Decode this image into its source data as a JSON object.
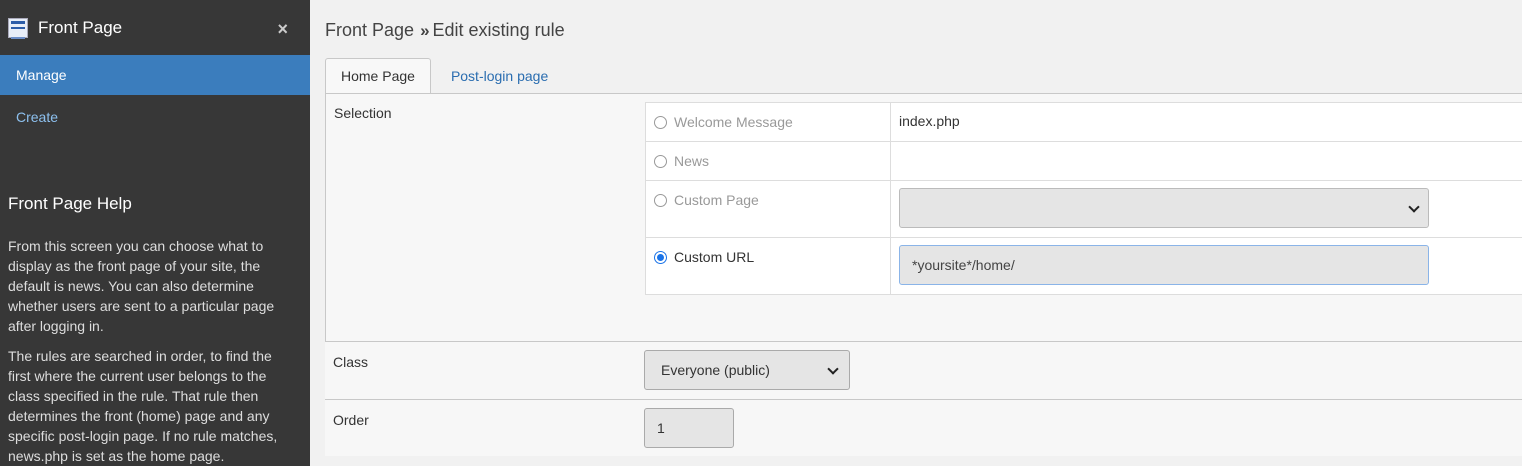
{
  "sidebar": {
    "title": "Front Page",
    "close_label": "×",
    "menu": [
      {
        "label": "Manage",
        "active": true
      },
      {
        "label": "Create",
        "active": false
      }
    ],
    "help_title": "Front Page Help",
    "help_paragraphs": [
      "From this screen you can choose what to display as the front page of your site, the default is news. You can also determine whether users are sent to a particular page after logging in.",
      "The rules are searched in order, to find the first where the current user belongs to the class specified in the rule. That rule then determines the front (home) page and any specific post-login page. If no rule matches, news.php is set as the home page."
    ]
  },
  "breadcrumb": {
    "section": "Front Page",
    "separator": "»",
    "current": "Edit existing rule"
  },
  "tabs": [
    {
      "label": "Home Page",
      "active": true
    },
    {
      "label": "Post-login page",
      "active": false
    }
  ],
  "selection": {
    "label": "Selection",
    "options": [
      {
        "label": "Welcome Message",
        "checked": false,
        "value": "index.php"
      },
      {
        "label": "News",
        "checked": false,
        "value": ""
      },
      {
        "label": "Custom Page",
        "checked": false,
        "value": ""
      },
      {
        "label": "Custom URL",
        "checked": true,
        "value": "*yoursite*/home/"
      }
    ]
  },
  "class_field": {
    "label": "Class",
    "selected": "Everyone (public)"
  },
  "order_field": {
    "label": "Order",
    "value": "1"
  },
  "colors": {
    "sidebar_bg": "#373737",
    "active_menu": "#3b7dbd",
    "link": "#2a6db0"
  }
}
